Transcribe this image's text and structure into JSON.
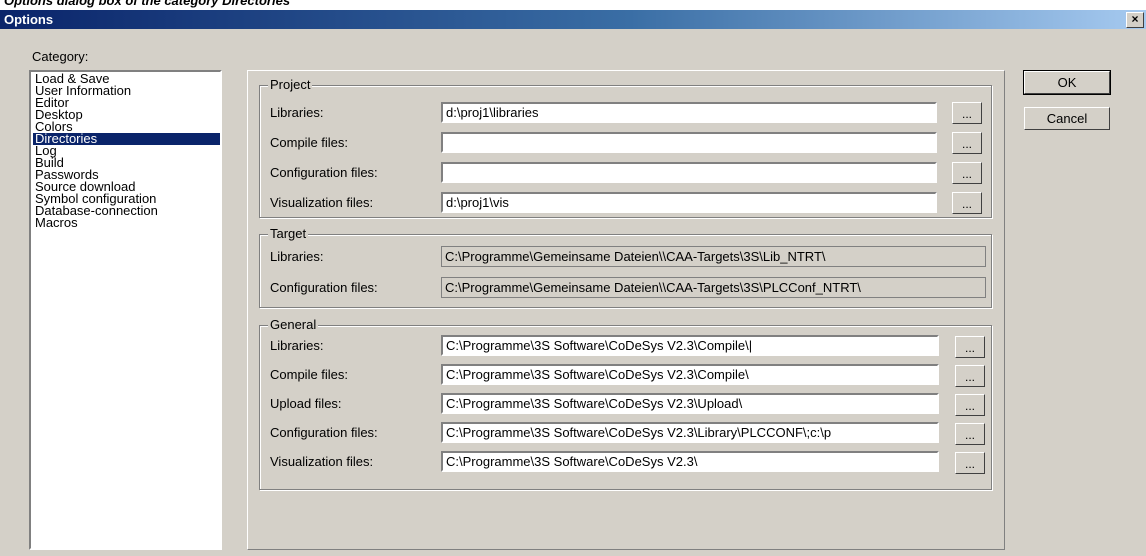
{
  "caption": "Options dialog box of the category Directories",
  "title": "Options",
  "close_glyph": "×",
  "category_label": "Category:",
  "categories": [
    {
      "label": "Load & Save"
    },
    {
      "label": "User Information"
    },
    {
      "label": "Editor"
    },
    {
      "label": "Desktop"
    },
    {
      "label": "Colors"
    },
    {
      "label": "Directories",
      "selected": true
    },
    {
      "label": "Log"
    },
    {
      "label": "Build"
    },
    {
      "label": "Passwords"
    },
    {
      "label": "Source download"
    },
    {
      "label": "Symbol configuration"
    },
    {
      "label": "Database-connection"
    },
    {
      "label": "Macros"
    }
  ],
  "browse_label": "...",
  "project": {
    "title": "Project",
    "rows": [
      {
        "label": "Libraries:",
        "value": "d:\\proj1\\libraries"
      },
      {
        "label": "Compile files:",
        "value": ""
      },
      {
        "label": "Configuration files:",
        "value": ""
      },
      {
        "label": "Visualization files:",
        "value": "d:\\proj1\\vis"
      }
    ]
  },
  "target": {
    "title": "Target",
    "rows": [
      {
        "label": "Libraries:",
        "value": "C:\\Programme\\Gemeinsame Dateien\\\\CAA-Targets\\3S\\Lib_NTRT\\"
      },
      {
        "label": "Configuration files:",
        "value": "C:\\Programme\\Gemeinsame Dateien\\\\CAA-Targets\\3S\\PLCConf_NTRT\\"
      }
    ]
  },
  "general": {
    "title": "General",
    "rows": [
      {
        "label": "Libraries:",
        "value": "C:\\Programme\\3S Software\\CoDeSys V2.3\\Compile\\|"
      },
      {
        "label": "Compile files:",
        "value": "C:\\Programme\\3S Software\\CoDeSys V2.3\\Compile\\"
      },
      {
        "label": "Upload files:",
        "value": "C:\\Programme\\3S Software\\CoDeSys V2.3\\Upload\\"
      },
      {
        "label": "Configuration files:",
        "value": "C:\\Programme\\3S Software\\CoDeSys V2.3\\Library\\PLCCONF\\;c:\\p"
      },
      {
        "label": "Visualization files:",
        "value": "C:\\Programme\\3S Software\\CoDeSys V2.3\\"
      }
    ]
  },
  "buttons": {
    "ok": "OK",
    "cancel": "Cancel"
  }
}
